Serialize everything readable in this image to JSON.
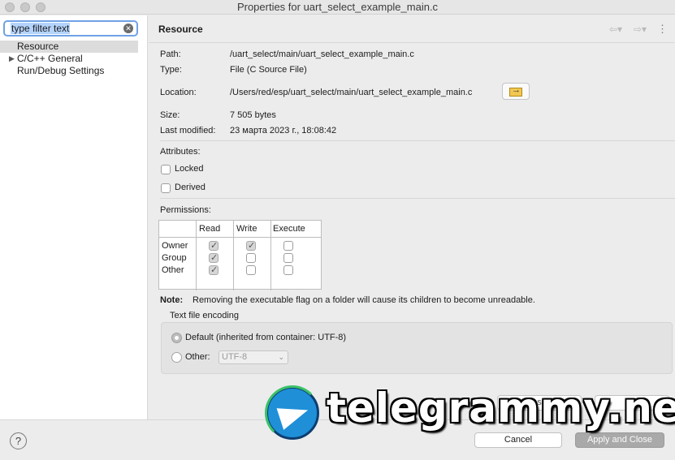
{
  "window": {
    "title": "Properties for uart_select_example_main.c"
  },
  "sidebar": {
    "filter_text": "type filter text",
    "items": [
      {
        "label": "Resource"
      },
      {
        "label": "C/C++ General"
      },
      {
        "label": "Run/Debug Settings"
      }
    ]
  },
  "resource": {
    "title": "Resource",
    "path_label": "Path:",
    "path_value": "/uart_select/main/uart_select_example_main.c",
    "type_label": "Type:",
    "type_value": "File  (C Source File)",
    "location_label": "Location:",
    "location_value": "/Users/red/esp/uart_select/main/uart_select_example_main.c",
    "size_label": "Size:",
    "size_value": "7 505  bytes",
    "modified_label": "Last modified:",
    "modified_value": "23 марта 2023 г., 18:08:42",
    "attributes_label": "Attributes:",
    "locked_label": "Locked",
    "derived_label": "Derived",
    "locked_checked": false,
    "derived_checked": false
  },
  "permissions": {
    "label": "Permissions:",
    "columns": [
      "Read",
      "Write",
      "Execute"
    ],
    "rows": [
      {
        "name": "Owner",
        "read": true,
        "write": true,
        "execute": false
      },
      {
        "name": "Group",
        "read": true,
        "write": false,
        "execute": false
      },
      {
        "name": "Other",
        "read": true,
        "write": false,
        "execute": false
      }
    ],
    "note_label": "Note:",
    "note_text": "Removing the executable flag on a folder will cause its children to become unreadable."
  },
  "encoding": {
    "label": "Text file encoding",
    "default_option": "Default (inherited from container: UTF-8)",
    "other_option": "Other:",
    "other_value": "UTF-8",
    "selected": "default"
  },
  "buttons": {
    "cancel": "Cancel",
    "apply_close": "Apply and Close",
    "restore_partial": "s",
    "apply_partial": ""
  },
  "watermark": {
    "text": "telegrammy.net"
  },
  "icons": {
    "help": "help-icon",
    "clear": "clear-icon",
    "back": "back-arrow-icon",
    "forward": "forward-arrow-icon",
    "menu": "kebab-menu-icon",
    "open_location": "open-folder-icon"
  }
}
